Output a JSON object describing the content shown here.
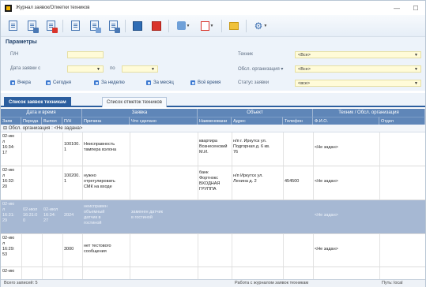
{
  "window": {
    "title": "Журнал заявок/Отметки техников",
    "minimize": "—",
    "maximize": "☐"
  },
  "params": {
    "title": "Параметры",
    "pn_label": "П/Н",
    "pn_value": "",
    "date_label": "Дата заявки с",
    "date_from": "",
    "po_label": "по",
    "date_to": "",
    "tech_label": "Техник",
    "tech_value": "<Все>",
    "org_label": "Обсл. организация ▾",
    "org_value": "<Все>",
    "status_label": "Статус заявки",
    "status_value": "<все>",
    "quick": [
      "Вчера",
      "Сегодня",
      "За неделю",
      "За месяц",
      "Всё время"
    ]
  },
  "tabs": [
    "Список заявок техникам",
    "Список отметок техников"
  ],
  "grid": {
    "bands": [
      "Дата и время",
      "Заявка",
      "Объект",
      "Техник / Обсл. организация"
    ],
    "columns": [
      "Заяв",
      "Переда",
      "Выпол",
      "П/Н",
      "Причина",
      "Что сделано",
      "Наименовани",
      "Адрес",
      "Телефон",
      "Ф.И.О.",
      "Отдел"
    ],
    "group_label": "Обсл. организация : <Не задана>",
    "rows": [
      {
        "zayav": "02-ию\nл\n16:34:\n17",
        "pered": "",
        "vypol": "",
        "pn": "100100.\n1",
        "prichina": "Неисправность\nтампера вэлона",
        "sdelano": "",
        "naim": "квартира\nВознесенский\nМ.И.",
        "adres": "н/п г. Иркутск ул.\nПодгорная д. 6 кв.\n76",
        "telefon": "",
        "fio": "<Не задан>",
        "otdel": ""
      },
      {
        "zayav": "02-ию\nл\n16:32:\n20",
        "pered": "",
        "vypol": "",
        "pn": "100200.\n1",
        "prichina": "нужно\nотрегулировать\nСМК на входе",
        "sdelano": "",
        "naim": "банк\nФортнокс\nВХОДНАЯ\nГРУППА",
        "adres": "н/п Иркутск ул.\nЛенина д. 2",
        "telefon": "454500",
        "fio": "<Не задан>",
        "otdel": ""
      },
      {
        "zayav": "02-ию\nл\n16:31:\n29",
        "pered": "02-июл\n16:31:0\n0",
        "vypol": "02-июл\n16:34:\n27",
        "pn": "2024",
        "prichina": "неисправен\nобъемный\nдатчик в\nгостиной",
        "sdelano": "заменен датчик\nв гостиной",
        "naim": "",
        "adres": "",
        "telefon": "",
        "fio": "<Не задан>",
        "otdel": ""
      },
      {
        "zayav": "02-ию\nл\n16:29:\n53",
        "pered": "",
        "vypol": "",
        "pn": "3000",
        "prichina": "нет тестового\nсообщения",
        "sdelano": "",
        "naim": "",
        "adres": "",
        "telefon": "",
        "fio": "<Не задан>",
        "otdel": ""
      },
      {
        "zayav": "02-ию",
        "pered": "",
        "vypol": "",
        "pn": "",
        "prichina": "",
        "sdelano": "",
        "naim": "",
        "adres": "",
        "telefon": "",
        "fio": "",
        "otdel": ""
      }
    ]
  },
  "status": {
    "total": "Всего записей: 5",
    "work": "Работа с журналом заявок техникам",
    "path": "Путь: local"
  }
}
